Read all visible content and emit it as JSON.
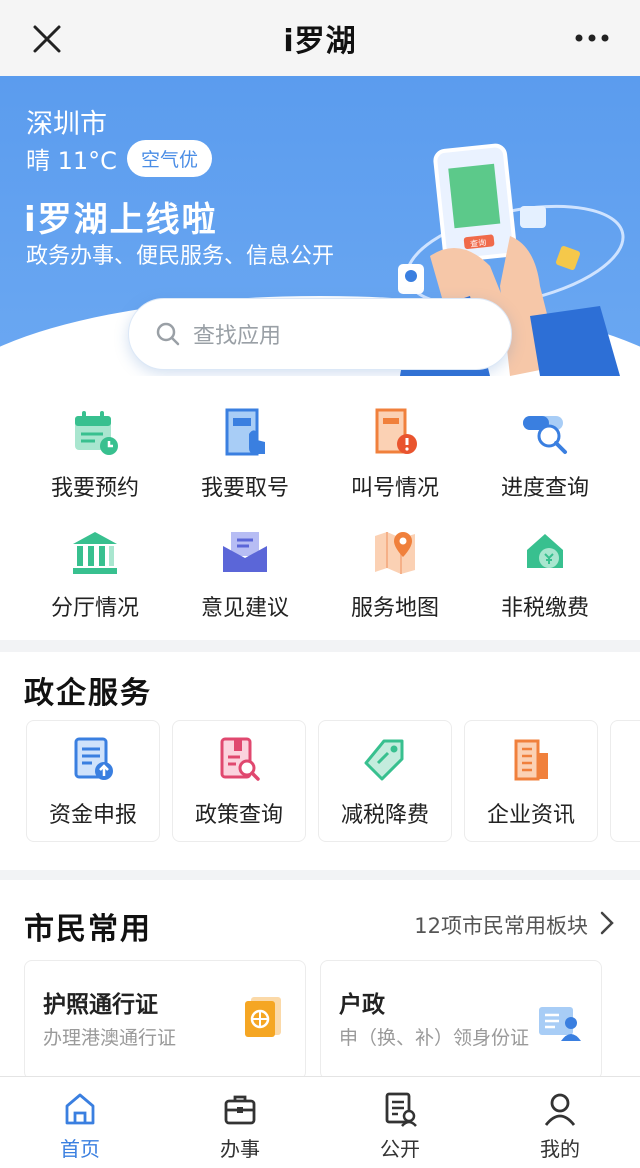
{
  "topbar": {
    "title": "i罗湖"
  },
  "hero": {
    "city": "深圳市",
    "weather": "晴 11°C",
    "aqi": "空气优",
    "headline": "i罗湖上线啦",
    "subline": "政务办事、便民服务、信息公开",
    "art_badge": "查询"
  },
  "search": {
    "placeholder": "查找应用"
  },
  "quick": {
    "items": [
      {
        "label": "我要预约",
        "icon": "calendar-icon"
      },
      {
        "label": "我要取号",
        "icon": "ticket-icon"
      },
      {
        "label": "叫号情况",
        "icon": "queue-icon"
      },
      {
        "label": "进度查询",
        "icon": "progress-search-icon"
      },
      {
        "label": "分厅情况",
        "icon": "building-icon"
      },
      {
        "label": "意见建议",
        "icon": "mail-icon"
      },
      {
        "label": "服务地图",
        "icon": "map-icon"
      },
      {
        "label": "非税缴费",
        "icon": "payment-icon"
      }
    ]
  },
  "gov": {
    "title": "政企服务",
    "items": [
      {
        "label": "资金申报",
        "icon": "fund-report-icon"
      },
      {
        "label": "政策查询",
        "icon": "policy-search-icon"
      },
      {
        "label": "减税降费",
        "icon": "tag-icon"
      },
      {
        "label": "企业资讯",
        "icon": "enterprise-icon"
      }
    ]
  },
  "citizen": {
    "title": "市民常用",
    "more": "12项市民常用板块",
    "cards": [
      {
        "title": "护照通行证",
        "subtitle": "办理港澳通行证",
        "icon": "passport-icon"
      },
      {
        "title": "户政",
        "subtitle": "申（换、补）领身份证",
        "icon": "id-card-icon"
      }
    ]
  },
  "tabbar": {
    "tabs": [
      {
        "label": "首页",
        "icon": "home-icon",
        "active": true
      },
      {
        "label": "办事",
        "icon": "briefcase-icon"
      },
      {
        "label": "公开",
        "icon": "document-icon"
      },
      {
        "label": "我的",
        "icon": "user-icon"
      }
    ]
  },
  "colors": {
    "accent": "#3a7fe0",
    "banner": "#5b9cee"
  }
}
